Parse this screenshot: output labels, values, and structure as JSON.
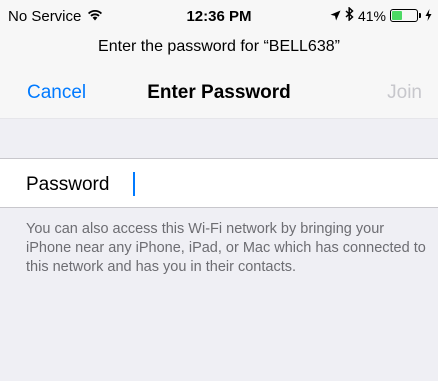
{
  "status_bar": {
    "carrier": "No Service",
    "time": "12:36 PM",
    "battery_percent": "41%",
    "battery_level": 0.41,
    "icons": [
      "wifi-icon",
      "location-icon",
      "bluetooth-icon",
      "battery-icon",
      "charging-icon"
    ]
  },
  "prompt": "Enter the password for “BELL638”",
  "nav": {
    "cancel_label": "Cancel",
    "title": "Enter Password",
    "join_label": "Join"
  },
  "password_field": {
    "label": "Password",
    "value": ""
  },
  "footer_note": "You can also access this Wi-Fi network by bringing your iPhone near any iPhone, iPad, or Mac which has connected to this network and has you in their contacts.",
  "colors": {
    "accent": "#007aff",
    "disabled": "#c7c7cc",
    "battery": "#4cd964",
    "background": "#efeff4"
  }
}
